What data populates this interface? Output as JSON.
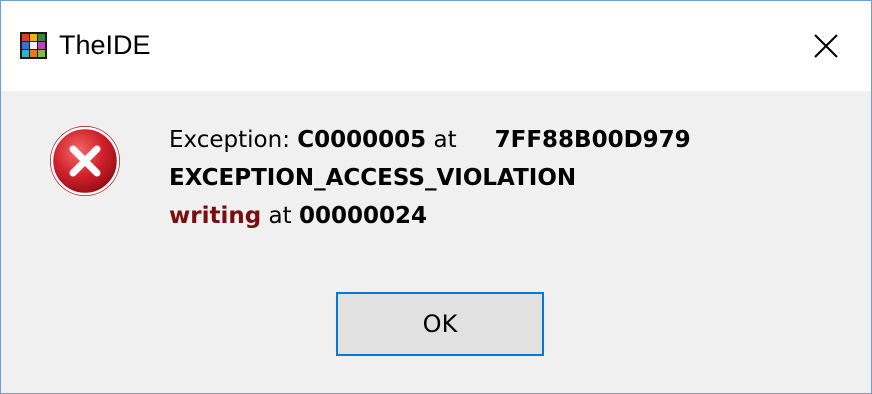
{
  "window": {
    "title": "TheIDE",
    "app_icon": "theide-app-icon",
    "close_icon": "close-icon"
  },
  "message": {
    "icon": "error-icon",
    "line1_prefix": "Exception: ",
    "exception_code": "C0000005",
    "at_label": " at",
    "address": "7FF88B00D979",
    "exception_name": "EXCEPTION_ACCESS_VIOLATION",
    "operation": "writing",
    "at_label2": " at ",
    "target_address": "00000024"
  },
  "buttons": {
    "ok_label": "OK"
  },
  "colors": {
    "border": "#6f9ed6",
    "dialog_bg": "#f0f0f0",
    "button_focus": "#0078d7",
    "operation_text": "#7a0d0d",
    "error_red": "#d1202b"
  }
}
